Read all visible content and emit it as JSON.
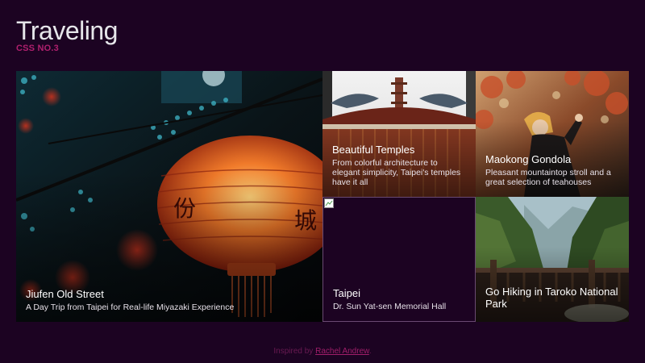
{
  "header": {
    "title": "Traveling",
    "subtitle": "CSS NO.3"
  },
  "cards": [
    {
      "title": "Jiufen Old Street",
      "description": "A Day Trip from Taipei for Real-life Miyazaki Experience",
      "image": "red-lantern-photo"
    },
    {
      "title": "Beautiful Temples",
      "description": "From colorful architecture to elegant simplicity, Taipei's temples have it all",
      "image": "temple-roof-photo"
    },
    {
      "title": "Maokong Gondola",
      "description": "Pleasant mountaintop stroll and a great selection of teahouses",
      "image": "person-autumn-photo"
    },
    {
      "title": "Taipei",
      "description": "Dr. Sun Yat-sen Memorial Hall",
      "image": "broken-image-icon"
    },
    {
      "title": "Go Hiking in Taroko National Park",
      "description": "",
      "image": "mountain-gorge-photo"
    }
  ],
  "footer": {
    "prefix": "Inspired by",
    "link_text": "Rachel Andrew",
    "suffix": "."
  },
  "colors": {
    "background": "#1c0322",
    "accent": "#b0206e",
    "title": "#e6e6ea"
  }
}
